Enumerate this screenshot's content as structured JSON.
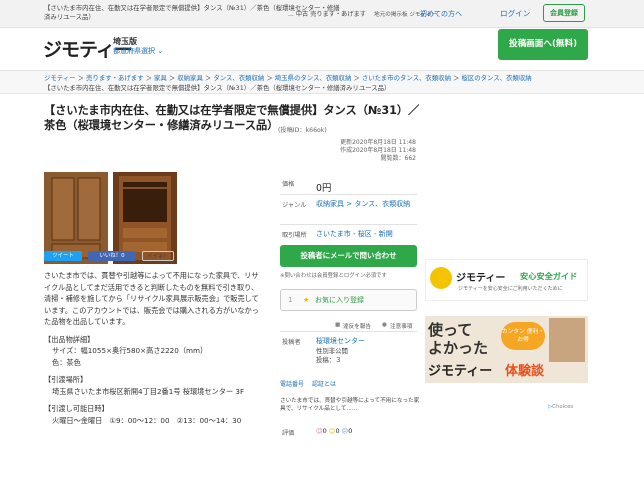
{
  "topbar": {
    "crumb": "【さいたま市内在住、在勤又は在学者限定で無償提供】タンス（№31）／茶色（桜環境センター・修繕済みリユース品）",
    "mid": "... 中古 売ります・あげます",
    "adv": "地元の掲示板 ジモティー",
    "first_time": "初めての方へ",
    "login": "ログイン",
    "register": "会員登録"
  },
  "header": {
    "logo": "ジモティー",
    "pref": "埼玉版",
    "pref_select": "都道府県選択 ⌄",
    "post_button": "投稿画面へ(無料)"
  },
  "breadcrumb": {
    "line1": [
      "ジモティー",
      "売ります・あげます",
      "家具",
      "収納家具",
      "タンス、衣類収納",
      "埼玉県のタンス、衣類収納",
      "さいたま市のタンス、衣類収納",
      "桜区のタンス、衣類収納"
    ],
    "line2": "【さいたま市内在住、在勤又は在学者限定で無償提供】タンス（№31）／茶色（桜環境センター・修繕済みリユース品）"
  },
  "item": {
    "title": "【さいたま市内在住、在勤又は在学者限定で無償提供】タンス（№31）／茶色（桜環境センター・修繕済みリユース品）",
    "post_id": "(投稿ID：k66ok)",
    "updated": "更新2020年8月18日 11:48",
    "created": "作成2020年8月18日 11:48",
    "views": "閲覧数：662"
  },
  "sns": {
    "tweet": "ツイート",
    "like": "いいね！0",
    "iine": "イイネ！"
  },
  "body": {
    "intro": "さいたま市では、貫替や引越等によって不用になった家具で、リサイクル品としてまだ活用できると判断したものを無料で引き取り、清掃・補修を施してから「リサイクル家具展示販売会」で販売しています。このアカウントでは、販売会では購入される方がいなかった品物を出品しています。",
    "h1": "【出品物詳細】",
    "size": "サイズ：幅1055×奥行580×高さ2220（mm）",
    "color": "色：茶色",
    "h2": "【引渡場所】",
    "place": "埼玉県さいたま市桜区新開4丁目2番1号 桜環境センター 3F",
    "h3": "【引渡し可能日時】",
    "time": "火曜日～金曜日　①9：00～12：00　②13：00～14：30"
  },
  "details": {
    "price_label": "価格",
    "price": "0円",
    "genre_label": "ジャンル",
    "genre": "収納家具 > タンス、衣類収納",
    "area_label": "取引場所",
    "area": "さいたま市 - 桜区 - 新開",
    "mail_button": "投稿者にメールで問い合わせ",
    "note": "※問い合わせは会員登録とログイン必須です",
    "fav_count": "1",
    "fav_label": "お気に入り登録",
    "report": "違反を報告",
    "caution": "注意事項",
    "poster_label": "投稿者",
    "poster": "桜環境センター",
    "gender": "性別非公開",
    "posts": "投稿：３",
    "tag1": "電話番号",
    "tag2": "認証とは",
    "desc": "さいたま市では、貫替や引越等によって不用になった家具で、リサイクル品として......",
    "eval_label": "評価",
    "eval": [
      "0",
      "0",
      "0"
    ]
  },
  "ads": {
    "guide_brand": "ジモティー",
    "guide_title": "安心安全ガイド",
    "guide_sub": "ジモティーを安心安全にご利用いただくために",
    "exp_line1": "使って",
    "exp_line2": "よかった",
    "exp_badge": "カンタン 便利・お得",
    "exp_brand": "ジモティー",
    "exp_title": "体験談",
    "choices": "Choices"
  },
  "colors": {
    "green": "#2fa84a",
    "link": "#1a6fb5"
  }
}
